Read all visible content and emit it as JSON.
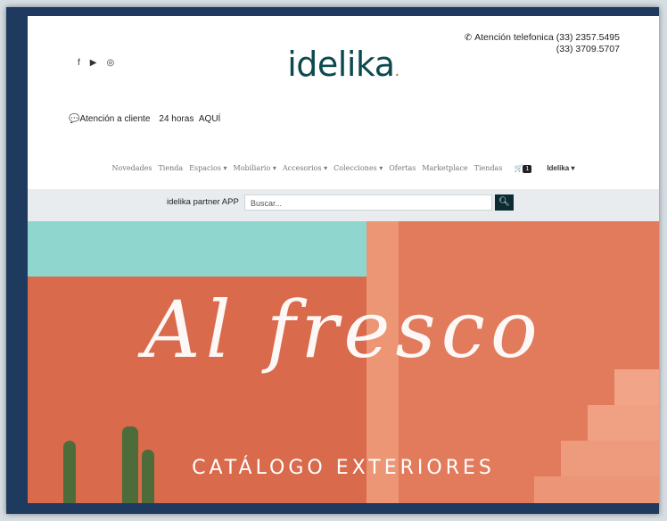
{
  "social": {
    "facebook": "f",
    "youtube": "▶",
    "instagram": "◎"
  },
  "logo": {
    "text": "idelika",
    "dot": "."
  },
  "contact": {
    "label": "Atención telefonica",
    "phone1": "(33) 2357.5495",
    "phone2": "(33) 3709.5707"
  },
  "attention": {
    "label": "Atención a cliente",
    "hours": "24 horas",
    "link": "AQUÍ"
  },
  "nav": {
    "items": [
      "Novedades",
      "Tienda",
      "Espacios ▾",
      "Mobiliario ▾",
      "Accesorios ▾",
      "Colecciones ▾",
      "Ofertas",
      "Marketplace",
      "Tiendas"
    ],
    "cart_count": "1",
    "brand_menu": "Idelika ▾"
  },
  "search": {
    "partner_label": "idelika partner APP",
    "placeholder": "Buscar..."
  },
  "hero": {
    "script_title": "Al fresco",
    "catalog_title": "CATÁLOGO EXTERIORES"
  }
}
